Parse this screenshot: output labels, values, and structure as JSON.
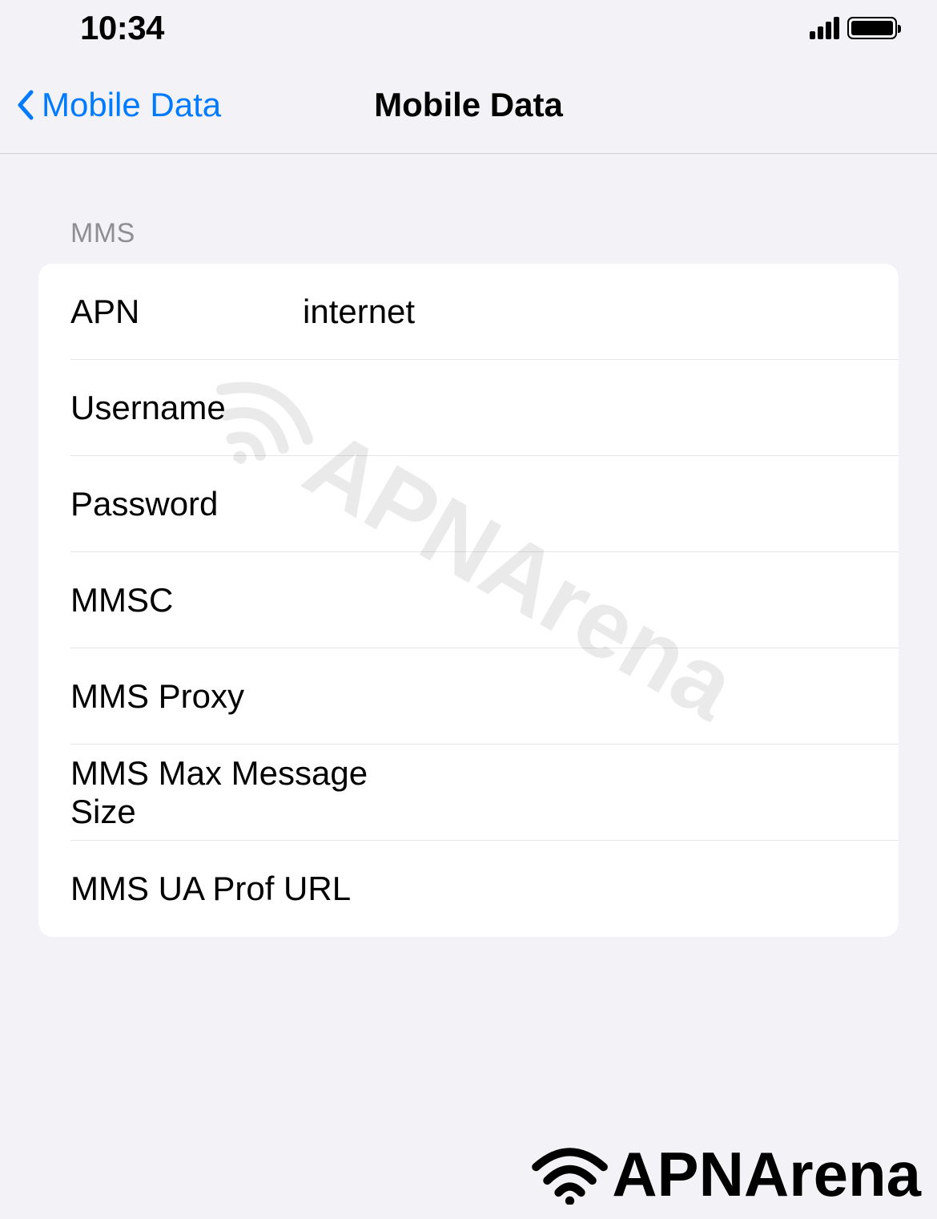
{
  "statusBar": {
    "time": "10:34"
  },
  "nav": {
    "backLabel": "Mobile Data",
    "title": "Mobile Data"
  },
  "section": {
    "header": "MMS",
    "rows": {
      "apn": {
        "label": "APN",
        "value": "internet"
      },
      "username": {
        "label": "Username",
        "value": ""
      },
      "password": {
        "label": "Password",
        "value": ""
      },
      "mmsc": {
        "label": "MMSC",
        "value": ""
      },
      "mmsProxy": {
        "label": "MMS Proxy",
        "value": ""
      },
      "mmsMaxSize": {
        "label": "MMS Max Message Size",
        "value": ""
      },
      "mmsUaProf": {
        "label": "MMS UA Prof URL",
        "value": ""
      }
    }
  },
  "branding": {
    "name": "APNArena"
  }
}
